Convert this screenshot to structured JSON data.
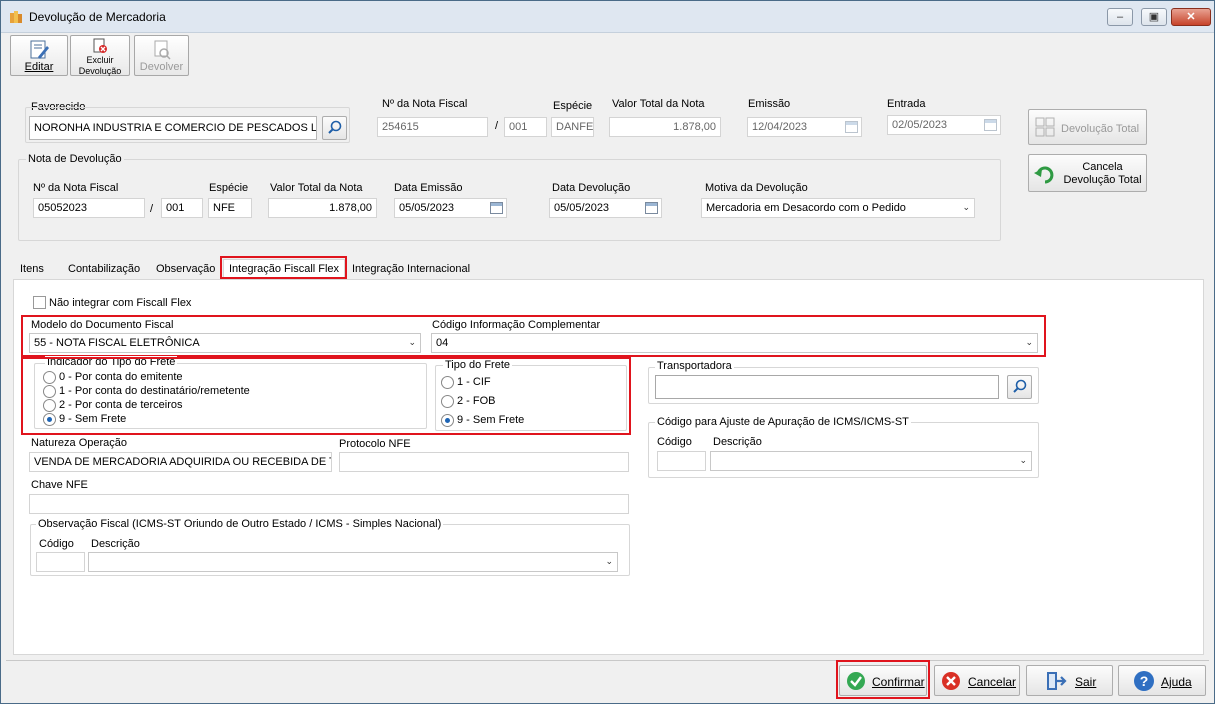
{
  "window": {
    "title": "Devolução de Mercadoria"
  },
  "toolbar": {
    "editar": "Editar",
    "excluir_l1": "Excluir",
    "excluir_l2": "Devolução",
    "devolver": "Devolver"
  },
  "header": {
    "favorecido_label": "Favorecido",
    "favorecido_value": "NORONHA INDUSTRIA E COMERCIO DE PESCADOS LTD",
    "nf_label": "Nº da Nota Fiscal",
    "nf_value": "254615",
    "serie_sep": "/",
    "serie_value": "001",
    "especie_label": "Espécie",
    "especie_value": "DANFE",
    "valor_label": "Valor Total da Nota",
    "valor_value": "1.878,00",
    "emissao_label": "Emissão",
    "emissao_value": "12/04/2023",
    "entrada_label": "Entrada",
    "entrada_value": "02/05/2023"
  },
  "side_buttons": {
    "devolucao_total": "Devolução Total",
    "cancela_l1": "Cancela",
    "cancela_l2": "Devolução Total"
  },
  "nota_devolucao": {
    "group_label": "Nota de Devolução",
    "nf_label": "Nº da Nota Fiscal",
    "nf_value": "05052023",
    "serie_sep": "/",
    "serie_value": "001",
    "especie_label": "Espécie",
    "especie_value": "NFE",
    "valor_label": "Valor Total da Nota",
    "valor_value": "1.878,00",
    "data_emissao_label": "Data Emissão",
    "data_emissao_value": "05/05/2023",
    "data_devolucao_label": "Data Devolução",
    "data_devolucao_value": "05/05/2023",
    "motivo_label": "Motiva da Devolução",
    "motivo_value": "Mercadoria em Desacordo com o Pedido"
  },
  "tabs": [
    "Itens",
    "Contabilização",
    "Observação",
    "Integração Fiscall Flex",
    "Integração Internacional"
  ],
  "fiscall": {
    "nao_integrar": "Não integrar com Fiscall Flex",
    "modelo_label": "Modelo do Documento Fiscal",
    "modelo_value": "55 - NOTA FISCAL ELETRÔNICA",
    "codigo_info_label": "Código Informação Complementar",
    "codigo_info_value": "04",
    "indicador_label": "Indicador do Tipo do Frete",
    "indicador_options": [
      "0 - Por conta do emitente",
      "1 - Por conta do destinatário/remetente",
      "2 - Por conta de terceiros",
      "9 - Sem Frete"
    ],
    "tipo_frete_label": "Tipo do Frete",
    "tipo_frete_options": [
      "1 - CIF",
      "2 - FOB",
      "9 - Sem Frete"
    ],
    "transportadora_label": "Transportadora",
    "ajuste_label": "Código para Ajuste de Apuração de ICMS/ICMS-ST",
    "codigo_label": "Código",
    "descricao_label": "Descrição",
    "natureza_label": "Natureza Operação",
    "natureza_value": "VENDA DE MERCADORIA ADQUIRIDA OU RECEBIDA DE TEF",
    "protocolo_label": "Protocolo NFE",
    "chave_label": "Chave NFE",
    "obs_fiscal_label": "Observação Fiscal (ICMS-ST Oriundo de Outro Estado / ICMS - Simples Nacional)"
  },
  "footer": {
    "confirmar": "Confirmar",
    "cancelar": "Cancelar",
    "sair": "Sair",
    "ajuda": "Ajuda"
  }
}
